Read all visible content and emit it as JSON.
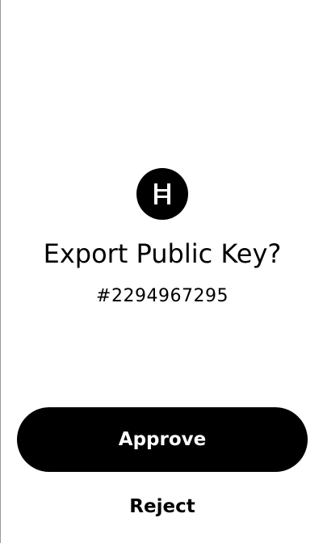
{
  "logo": {
    "icon": "hedera-logo-icon",
    "background": "#000000",
    "foreground": "#ffffff"
  },
  "prompt": {
    "title": "Export Public Key?",
    "account": "#2294967295"
  },
  "actions": {
    "approve_label": "Approve",
    "reject_label": "Reject"
  },
  "colors": {
    "primary": "#000000",
    "background": "#ffffff",
    "on_primary": "#ffffff"
  }
}
